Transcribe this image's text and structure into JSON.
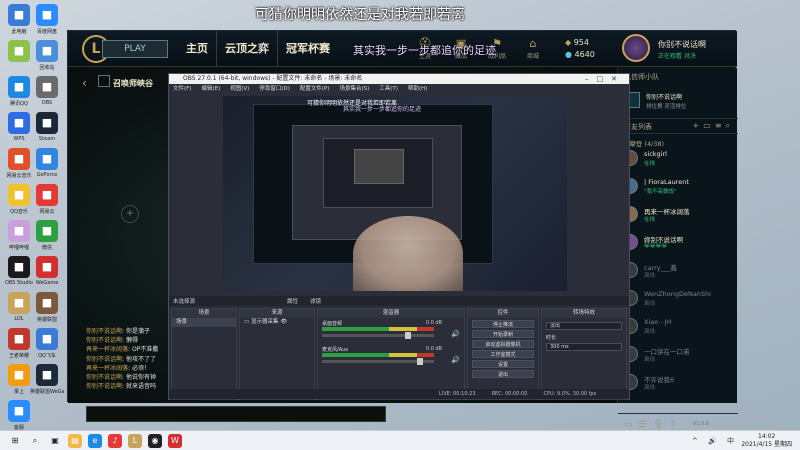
{
  "subtitles": {
    "top": "可猜你明明依然还是对我若即若离",
    "mid": "其实我一步一步都追你的足迹"
  },
  "desktop_icons": [
    {
      "label": "此电脑",
      "icon": "computer-icon",
      "color": "#3a7bd5"
    },
    {
      "label": "百度网盘",
      "icon": "cloud-icon",
      "color": "#2a8cff"
    },
    {
      "label": "",
      "icon": "shortcut-icon",
      "color": "#8bc34a"
    },
    {
      "label": "回收站",
      "icon": "recycle-icon",
      "color": "#4a90d9"
    },
    {
      "label": "腾讯QQ",
      "icon": "qq-icon",
      "color": "#1e88e5"
    },
    {
      "label": "OBS",
      "icon": "disk-icon",
      "color": "#6a6a6a"
    },
    {
      "label": "WPS",
      "icon": "wps-icon",
      "color": "#2d6ce5"
    },
    {
      "label": "Steam",
      "icon": "steam-icon",
      "color": "#1b2838"
    },
    {
      "label": "网易云音乐",
      "icon": "music-icon",
      "color": "#e0502b"
    },
    {
      "label": "GeForce",
      "icon": "game-icon",
      "color": "#2e86de"
    },
    {
      "label": "QQ音乐",
      "icon": "qqmusic-icon",
      "color": "#f2c12e"
    },
    {
      "label": "网易云",
      "icon": "netease-icon",
      "color": "#e53935"
    },
    {
      "label": "哔哩哔哩",
      "icon": "anime-icon",
      "color": "#c9a0dc"
    },
    {
      "label": "微信",
      "icon": "wechat-icon",
      "color": "#2ea043"
    },
    {
      "label": "OBS Studio",
      "icon": "obs-icon",
      "color": "#1a1a1a"
    },
    {
      "label": "WeGame",
      "icon": "wegame-icon",
      "color": "#d32f2f"
    },
    {
      "label": "LOL",
      "icon": "lol-icon",
      "color": "#c8a45a"
    },
    {
      "label": "英雄联盟",
      "icon": "hero-icon",
      "color": "#7a5a3a"
    },
    {
      "label": "王者荣耀",
      "icon": "kog-icon",
      "color": "#c0392b"
    },
    {
      "label": "QQ飞车",
      "icon": "car-icon",
      "color": "#3a7bd5"
    },
    {
      "label": "掌上",
      "icon": "app-icon",
      "color": "#f39c12"
    },
    {
      "label": "英雄联盟WeGame版",
      "icon": "lolwg-icon",
      "color": "#1a2a3a"
    },
    {
      "label": "客服",
      "icon": "help-icon",
      "color": "#2a8cff"
    }
  ],
  "client": {
    "logo": "L",
    "play_label": "PLAY",
    "nav": [
      "主页",
      "云顶之弈",
      "冠军杯赛"
    ],
    "small_nav": [
      {
        "icon": "helmet-icon",
        "label": "生涯"
      },
      {
        "icon": "bag-icon",
        "label": "藏品"
      },
      {
        "icon": "flag-icon",
        "label": "战利品"
      },
      {
        "icon": "store-icon",
        "label": "商城"
      }
    ],
    "blue_essence": "954",
    "riot_points": "4640",
    "username": "你别不说话啊",
    "user_status": "正在观看 对决",
    "mode_label": "召唤师峡谷",
    "back": "‹"
  },
  "chat": [
    {
      "name": "你别不说话啊",
      "msg": "你是蒲子"
    },
    {
      "name": "你别不说话啊",
      "msg": "懒得"
    },
    {
      "name": "再来一杯冰阔落",
      "msg": "OP不准撒"
    },
    {
      "name": "你别不说话啊",
      "msg": "他攻不了了"
    },
    {
      "name": "再来一杯冰阔落",
      "msg": "必须！"
    },
    {
      "name": "你别不说话啊",
      "msg": "他说你有钟"
    },
    {
      "name": "你别不说话啊",
      "msg": "就来语音吗"
    }
  ],
  "friends_panel": {
    "party_header": "私信师小队",
    "party_title": "你别不说话啊",
    "party_sub": "排位赛 灵活排位",
    "list_header": "好友列表",
    "group": "摩登 (4/38)",
    "friends": [
      {
        "name": "sickgirl",
        "status": "在线",
        "online": true,
        "color": "#6a4a3a"
      },
      {
        "name": "| FioraLaurent",
        "status": "\"我不高做饭\"",
        "online": true,
        "color": "#4a6a8a"
      },
      {
        "name": "再来一杯冰阔落",
        "status": "在线",
        "online": true,
        "color": "#8a6a4a"
      },
      {
        "name": "妳别不说话啊",
        "status": "😀😀😀😀",
        "online": true,
        "color": "#7a4a8a"
      },
      {
        "name": "carry___鑫",
        "status": "离线",
        "online": false,
        "color": "#3a3a3a"
      },
      {
        "name": "WenZhongDeNanShi",
        "status": "离线",
        "online": false,
        "color": "#3a3a3a"
      },
      {
        "name": "Xiao - JH",
        "status": "离线",
        "online": false,
        "color": "#3a3a3a"
      },
      {
        "name": "一口饼在一口弟",
        "status": "离线",
        "online": false,
        "color": "#3a3a3a"
      },
      {
        "name": "不许说我6",
        "status": "离线",
        "online": false,
        "color": "#3a3a3a"
      }
    ],
    "version": "V1.0.0"
  },
  "obs": {
    "title": "OBS 27.0.1 (64-bit, windows) - 配置文件: 未命名 - 场景: 未命名",
    "menu": [
      "文件(F)",
      "编辑(E)",
      "视图(V)",
      "停靠窗口(D)",
      "配置文件(P)",
      "场景集合(S)",
      "工具(T)",
      "帮助(H)"
    ],
    "preview_caption_1": "可猜你明明依然还是对我若即若离",
    "preview_caption_2": "其实我一步一步都追你的足迹",
    "dock_labels": {
      "scenes": "未选择源",
      "props": "属性",
      "filter": "滤镜"
    },
    "scenes_header": "场景",
    "scenes": [
      "场景"
    ],
    "sources_header": "来源",
    "sources": [
      "显示器采集"
    ],
    "mixer_header": "混音器",
    "mixer": [
      {
        "name": "桌面音频",
        "db": "0.0 dB",
        "level": 0.78
      },
      {
        "name": "麦克风/Aux",
        "db": "0.0 dB",
        "level": 0.9
      }
    ],
    "controls_header": "控件",
    "controls": [
      "停止推流",
      "开始录制",
      "启动虚拟摄像机",
      "工作室模式",
      "设置",
      "退出"
    ],
    "transitions_header": "转场特效",
    "transition": "淡出",
    "duration_label": "时长",
    "duration": "300 ms",
    "status": [
      "LIVE: 00:10:23",
      "REC: 00:00:00",
      "CPU: 9.0%, 30.00 fps"
    ]
  },
  "taskbar": {
    "icons": [
      "windows-icon",
      "search-icon",
      "taskview-icon",
      "folder-icon",
      "edge-icon",
      "netease-icon",
      "lol-icon",
      "obs-icon",
      "wegame-icon"
    ],
    "tray": "^ 🔊 中",
    "time": "14:02",
    "date": "2021/4/15 星期四"
  }
}
